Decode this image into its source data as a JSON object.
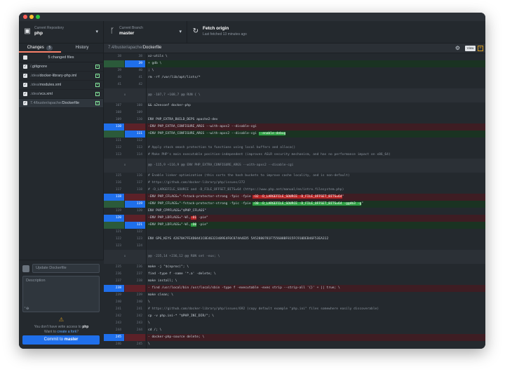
{
  "window": {
    "traffic_lights": [
      "#ff5f57",
      "#febc2e",
      "#28c840"
    ]
  },
  "toolbar": {
    "repo_label": "Current Repository",
    "repo_value": "php",
    "branch_label": "Current Branch",
    "branch_value": "master",
    "fetch_label": "Fetch origin",
    "fetch_sub": "Last fetched 13 minutes ago"
  },
  "sidebar": {
    "tab_changes": "Changes",
    "tab_changes_count": "5",
    "tab_history": "History",
    "changed_files_label": "5 changed files",
    "files": [
      {
        "dir": "/",
        "name": ".gitignore"
      },
      {
        "dir": ".idea/",
        "name": "docker-library-php.iml"
      },
      {
        "dir": ".idea/",
        "name": "modules.xml"
      },
      {
        "dir": ".idea/",
        "name": "vcs.xml"
      },
      {
        "dir": "7.4/buster/apache/",
        "name": "Dockerfile"
      }
    ]
  },
  "commit": {
    "summary_placeholder": "Update Dockerfile",
    "description_placeholder": "Description",
    "warning_prefix": "You don't have write access to",
    "warning_repo": "php",
    "warning_line2_prefix": "Want to",
    "warning_link": "create a fork",
    "warning_line2_suffix": "?",
    "button_prefix": "Commit to",
    "button_branch": "master"
  },
  "diff_header": {
    "path_dir": "7.4/buster/apache/",
    "path_file": "Dockerfile",
    "view_label": "View"
  },
  "colors": {
    "accent_blue": "#1f6feb",
    "added_green": "#2ea043",
    "removed_red": "#b62324",
    "warning_yellow": "#d29922"
  },
  "diff": [
    {
      "t": "ctx",
      "a": "38",
      "b": "38",
      "c": "        xz-utils \\"
    },
    {
      "t": "add",
      "a": "",
      "b": "39",
      "c": "+        gdb \\"
    },
    {
      "t": "ctx",
      "a": "39",
      "b": "40",
      "c": "    ; \\"
    },
    {
      "t": "ctx",
      "a": "40",
      "b": "41",
      "c": "    rm -rf /var/lib/apt/lists/*"
    },
    {
      "t": "ctx",
      "a": "41",
      "b": "42",
      "c": ""
    },
    {
      "t": "hunk",
      "a": "",
      "b": "",
      "c": "@@ -107,7 +108,7 @@ RUN { \\"
    },
    {
      "t": "ctx",
      "a": "107",
      "b": "108",
      "c": "    && a2enconf docker-php"
    },
    {
      "t": "ctx",
      "a": "108",
      "b": "109",
      "c": ""
    },
    {
      "t": "ctx",
      "a": "109",
      "b": "110",
      "c": " ENV PHP_EXTRA_BUILD_DEPS apache2-dev"
    },
    {
      "t": "del",
      "a": "110",
      "b": "",
      "c": "-ENV PHP_EXTRA_CONFIGURE_ARGS --with-apxs2 --disable-cgi"
    },
    {
      "t": "add",
      "a": "",
      "b": "111",
      "c": "+ENV PHP_EXTRA_CONFIGURE_ARGS --with-apxs2 --disable-cgi ",
      "h": "--enable-debug"
    },
    {
      "t": "ctx",
      "a": "111",
      "b": "112",
      "c": ""
    },
    {
      "t": "cmt",
      "a": "112",
      "b": "113",
      "c": " # Apply stack smash protection to functions using local buffers and alloca()"
    },
    {
      "t": "cmt",
      "a": "113",
      "b": "114",
      "c": " # Make PHP's main executable position-independent (improves ASLR security mechanism, and has no performance impact on x86_64)"
    },
    {
      "t": "hunk",
      "a": "",
      "b": "",
      "c": "@@ -115,9 +116,9 @@ ENV PHP_EXTRA_CONFIGURE_ARGS --with-apxs2 --disable-cgi"
    },
    {
      "t": "cmt",
      "a": "115",
      "b": "116",
      "c": " # Enable linker optimization (this sorts the hash buckets to improve cache locality, and is non-default)"
    },
    {
      "t": "cmt",
      "a": "116",
      "b": "117",
      "c": " # https://github.com/docker-library/php/issues/272"
    },
    {
      "t": "cmt",
      "a": "117",
      "b": "118",
      "c": " # -D_LARGEFILE_SOURCE and -D_FILE_OFFSET_BITS=64 (https://www.php.net/manual/en/intro.filesystem.php)"
    },
    {
      "t": "del",
      "a": "118",
      "b": "",
      "c": "-ENV PHP_CFLAGS=\"-fstack-protector-strong -fpic -fpie ",
      "h": "-O2 -D_LARGEFILE_SOURCE -D_FILE_OFFSET_BITS=64",
      "s": "\""
    },
    {
      "t": "add",
      "a": "",
      "b": "119",
      "c": "+ENV PHP_CFLAGS=\"-fstack-protector-strong -fpic -fpie ",
      "h": "-O0 -D_LARGEFILE_SOURCE -D_FILE_OFFSET_BITS=64 -ggdb3 -g",
      "s": "\""
    },
    {
      "t": "ctx",
      "a": "119",
      "b": "120",
      "c": " ENV PHP_CPPFLAGS=\"$PHP_CFLAGS\""
    },
    {
      "t": "del",
      "a": "120",
      "b": "",
      "c": "-ENV PHP_LDFLAGS=\"-Wl,",
      "h": "-O1",
      "s": " -pie\""
    },
    {
      "t": "add",
      "a": "",
      "b": "121",
      "c": "+ENV PHP_LDFLAGS=\"-Wl,",
      "h": "-O0",
      "s": " -pie\""
    },
    {
      "t": "ctx",
      "a": "121",
      "b": "122",
      "c": ""
    },
    {
      "t": "ctx",
      "a": "122",
      "b": "123",
      "c": " ENV GPG_KEYS 42670A7FE4D0441C8E46323489E4F0C874A4ED5 5A52880781F755608BF815FC910DEB46F53EA312"
    },
    {
      "t": "ctx",
      "a": "123",
      "b": "124",
      "c": ""
    },
    {
      "t": "hunk",
      "a": "",
      "b": "",
      "c": "@@ -235,14 +236,12 @@ RUN set -eux; \\"
    },
    {
      "t": "ctx",
      "a": "235",
      "b": "236",
      "c": "    make -j \"$(nproc)\"; \\"
    },
    {
      "t": "ctx",
      "a": "236",
      "b": "237",
      "c": "    find -type f -name '*.a' -delete; \\"
    },
    {
      "t": "ctx",
      "a": "237",
      "b": "238",
      "c": "    make install; \\"
    },
    {
      "t": "del",
      "a": "238",
      "b": "",
      "c": "-    find /usr/local/bin /usr/local/sbin -type f -executable -exec strip --strip-all '{}' + || true; \\"
    },
    {
      "t": "ctx",
      "a": "239",
      "b": "239",
      "c": "    make clean; \\"
    },
    {
      "t": "ctx",
      "a": "240",
      "b": "240",
      "c": "    \\"
    },
    {
      "t": "cmt",
      "a": "241",
      "b": "241",
      "c": " # https://github.com/docker-library/php/issues/692 (copy default example \"php.ini\" files somewhere easily discoverable)"
    },
    {
      "t": "ctx",
      "a": "242",
      "b": "242",
      "c": "    cp -v php.ini-* \"$PHP_INI_DIR/\"; \\"
    },
    {
      "t": "ctx",
      "a": "243",
      "b": "243",
      "c": "    \\"
    },
    {
      "t": "ctx",
      "a": "244",
      "b": "244",
      "c": "    cd /; \\"
    },
    {
      "t": "del",
      "a": "245",
      "b": "",
      "c": "-    docker-php-source delete; \\"
    },
    {
      "t": "ctx",
      "a": "246",
      "b": "245",
      "c": "    \\"
    },
    {
      "t": "cmt",
      "a": "247",
      "b": "246",
      "c": " # reset apt-mark's \"manual\" list so that \"purge --auto-remove\" will remove all build dependencies"
    }
  ]
}
